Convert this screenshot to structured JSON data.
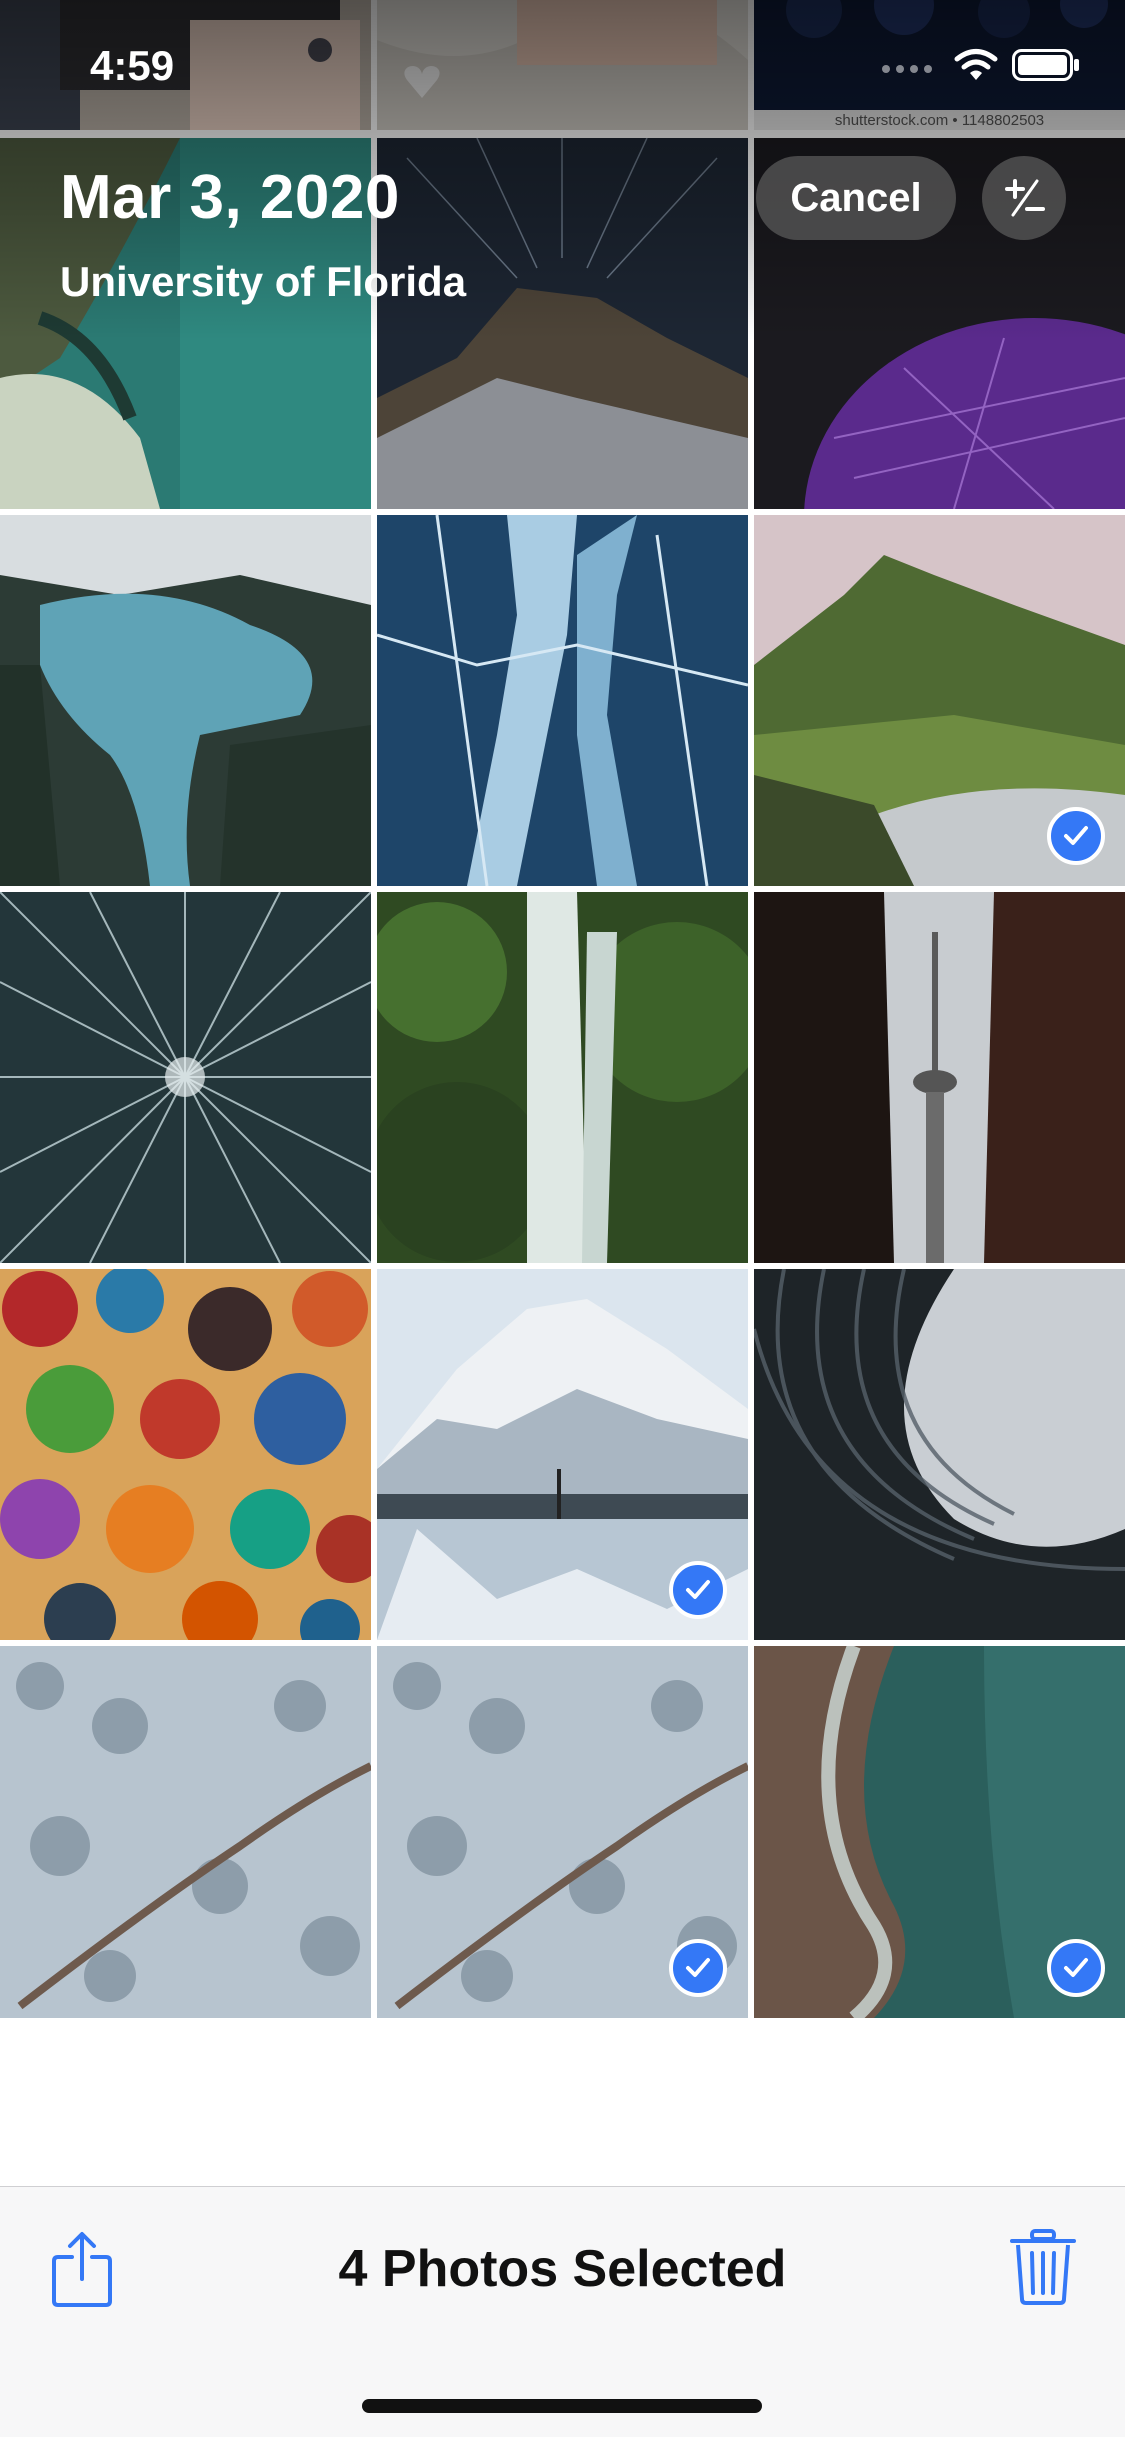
{
  "status_bar": {
    "time": "4:59"
  },
  "header": {
    "date": "Mar 3, 2020",
    "location": "University of Florida",
    "cancel_label": "Cancel",
    "zoom_label": "+/-"
  },
  "credit_text": "shutterstock.com • 1148802503",
  "photos": [
    {
      "label": "notebook on table",
      "selected": false
    },
    {
      "label": "box on fabric",
      "selected": false
    },
    {
      "label": "blueberries",
      "selected": false
    },
    {
      "label": "aerial coast",
      "selected": false
    },
    {
      "label": "star trails mountain",
      "selected": false
    },
    {
      "label": "purple dome",
      "selected": false
    },
    {
      "label": "alpine lake",
      "selected": false
    },
    {
      "label": "frozen ice",
      "selected": false
    },
    {
      "label": "green mountain",
      "selected": true
    },
    {
      "label": "light burst",
      "selected": false
    },
    {
      "label": "waterfall",
      "selected": false
    },
    {
      "label": "cn tower",
      "selected": false
    },
    {
      "label": "glass flowers",
      "selected": false
    },
    {
      "label": "snowy mountain reflection",
      "selected": true
    },
    {
      "label": "curved building",
      "selected": false
    },
    {
      "label": "snowy forest road",
      "selected": false
    },
    {
      "label": "snowy forest road 2",
      "selected": true
    },
    {
      "label": "aerial ocean",
      "selected": true
    }
  ],
  "toolbar": {
    "selected_label": "4 Photos Selected",
    "share_icon": "share-icon",
    "trash_icon": "trash-icon"
  },
  "colors": {
    "accent": "#3478f6"
  }
}
